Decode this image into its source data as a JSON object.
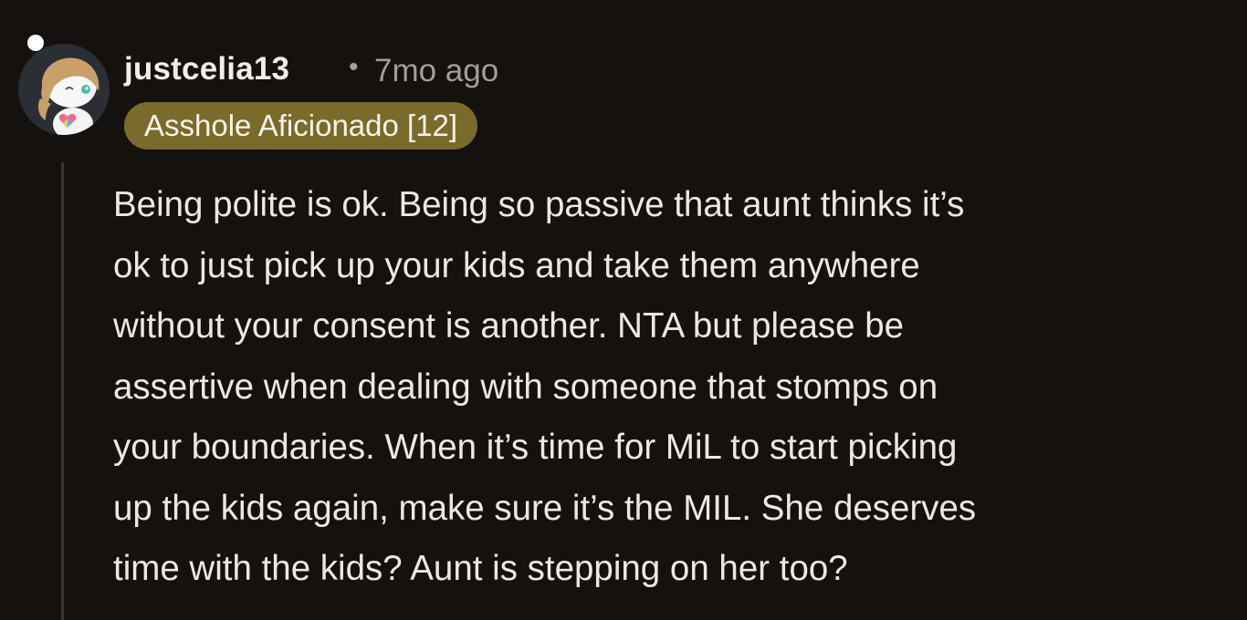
{
  "comment": {
    "username": "justcelia13",
    "separator": "•",
    "timestamp": "7mo ago",
    "flair": "Asshole Aficionado [12]",
    "body_lines": [
      "Being polite is ok. Being so passive that aunt thinks it’s",
      "ok to just pick up your kids and take them anywhere",
      "without your consent is another. NTA but please be",
      "assertive when dealing with someone that stomps on",
      "your boundaries. When it’s time for MiL to start picking",
      "up the kids again, make sure it’s the MIL. She deserves",
      "time with the kids? Aunt is stepping on her too?"
    ]
  },
  "colors": {
    "background": "#14110f",
    "flair_background": "#7a6a2c",
    "muted_text": "#a49e98",
    "thread_line": "#3a3633"
  },
  "icons": {
    "avatar": "snoo-avatar-icon"
  }
}
